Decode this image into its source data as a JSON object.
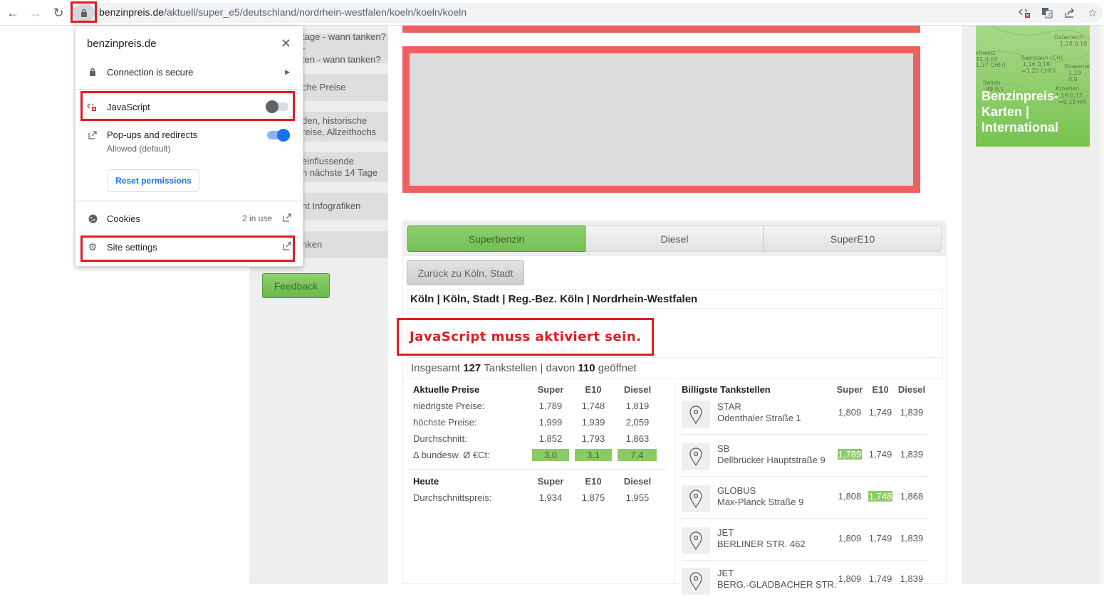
{
  "browser": {
    "url_host": "benzinpreis.de",
    "url_path": "/aktuell/super_e5/deutschland/nordrhein-westfalen/koeln/koeln/koeln",
    "icons": [
      "back-icon",
      "forward-icon",
      "reload-icon",
      "lock-icon",
      "javascript-blocked-icon",
      "translate-icon",
      "share-icon",
      "bookmark-star-icon"
    ]
  },
  "site_popup": {
    "title": "benzinpreis.de",
    "connection": "Connection is secure",
    "javascript": {
      "label": "JavaScript",
      "enabled": false
    },
    "popups": {
      "label": "Pop-ups and redirects",
      "sub": "Allowed (default)",
      "enabled": true
    },
    "reset_label": "Reset permissions",
    "cookies": {
      "label": "Cookies",
      "status": "2 in use"
    },
    "site_settings": "Site settings"
  },
  "sidebar": {
    "items": [
      {
        "line1": "tage - wann tanken? -",
        "line2": "ten - wann tanken?"
      },
      {
        "line1": "che Preise",
        "line2": ""
      },
      {
        "line1": "den, historische",
        "line2": "reise, Allzeithochs"
      },
      {
        "line1": "einflussende",
        "line2": "n nächste 14 Tage"
      },
      {
        "line1": "nt Infografiken",
        "line2": ""
      },
      {
        "line1": "nken",
        "line2": ""
      }
    ],
    "feedback": "Feedback"
  },
  "ad_right": {
    "title_line1": "Benzinpreis-",
    "title_line2": "Karten |",
    "title_line3": "International",
    "map_labels": [
      "Österreich",
      "1,18 0,18",
      "chweiz",
      "31 0,03",
      "1,37 CHF/l",
      "Samnaun (CH)",
      "1,16 0,18",
      "≈1,22 CHF/l",
      "Slowenie",
      "1,29 0,0",
      "Italien",
      "49 0,1",
      "Kroatien",
      "1,19 0,15",
      "≈9,19 HR"
    ]
  },
  "fuel_tabs": [
    {
      "label": "Superbenzin",
      "active": true
    },
    {
      "label": "Diesel",
      "active": false
    },
    {
      "label": "SuperE10",
      "active": false
    }
  ],
  "back_button": "Zurück zu Köln, Stadt",
  "location": {
    "parts": [
      "Köln",
      "Köln, Stadt",
      "Reg.-Bez. Köln",
      "Nordrhein-Westfalen"
    ],
    "sep": " | "
  },
  "js_warning": "JavaScript muss aktiviert sein.",
  "counts": {
    "prefix": "Insgesamt",
    "total": "127",
    "middle": "Tankstellen | davon",
    "open": "110",
    "suffix": "geöffnet"
  },
  "current_prices": {
    "header": [
      "Aktuelle Preise",
      "Super",
      "E10",
      "Diesel"
    ],
    "rows": [
      {
        "label": "niedrigste Preise:",
        "values": [
          "1,789",
          "1,748",
          "1,819"
        ]
      },
      {
        "label": "höchste Preise:",
        "values": [
          "1,999",
          "1,939",
          "2,059"
        ]
      },
      {
        "label": "Durchschnitt:",
        "values": [
          "1,852",
          "1,793",
          "1,863"
        ]
      },
      {
        "label": "Δ bundesw. Ø €Ct:",
        "values": [
          "3,0",
          "3,1",
          "7,4"
        ]
      }
    ]
  },
  "today": {
    "header": [
      "Heute",
      "Super",
      "E10",
      "Diesel"
    ],
    "rows": [
      {
        "label": "Durchschnittspreis:",
        "values": [
          "1,934",
          "1,875",
          "1,955"
        ]
      }
    ]
  },
  "cheapest": {
    "header": [
      "Billigste Tankstellen",
      "Super",
      "E10",
      "Diesel"
    ],
    "stations": [
      {
        "brand": "STAR",
        "address": "Odenthaler Straße 1",
        "prices": [
          "1,809",
          "1,749",
          "1,839"
        ],
        "highlight": -1
      },
      {
        "brand": "SB",
        "address": "Dellbrücker Hauptstraße 9",
        "prices": [
          "1,789",
          "1,749",
          "1,839"
        ],
        "highlight": 0
      },
      {
        "brand": "GLOBUS",
        "address": "Max-Planck Straße 9",
        "prices": [
          "1,808",
          "1,748",
          "1,868"
        ],
        "highlight": 1
      },
      {
        "brand": "JET",
        "address": "BERLINER STR. 462",
        "prices": [
          "1,809",
          "1,749",
          "1,839"
        ],
        "highlight": -1
      },
      {
        "brand": "JET",
        "address": "BERG.-GLADBACHER STR.",
        "prices": [
          "1,809",
          "1,749",
          "1,839"
        ],
        "highlight": -1
      }
    ]
  },
  "colors": {
    "accent_green": "#8bcb67",
    "warning_red": "#e11b22",
    "ad_red": "#ef5f5f",
    "chrome_blue": "#1a73e8"
  }
}
